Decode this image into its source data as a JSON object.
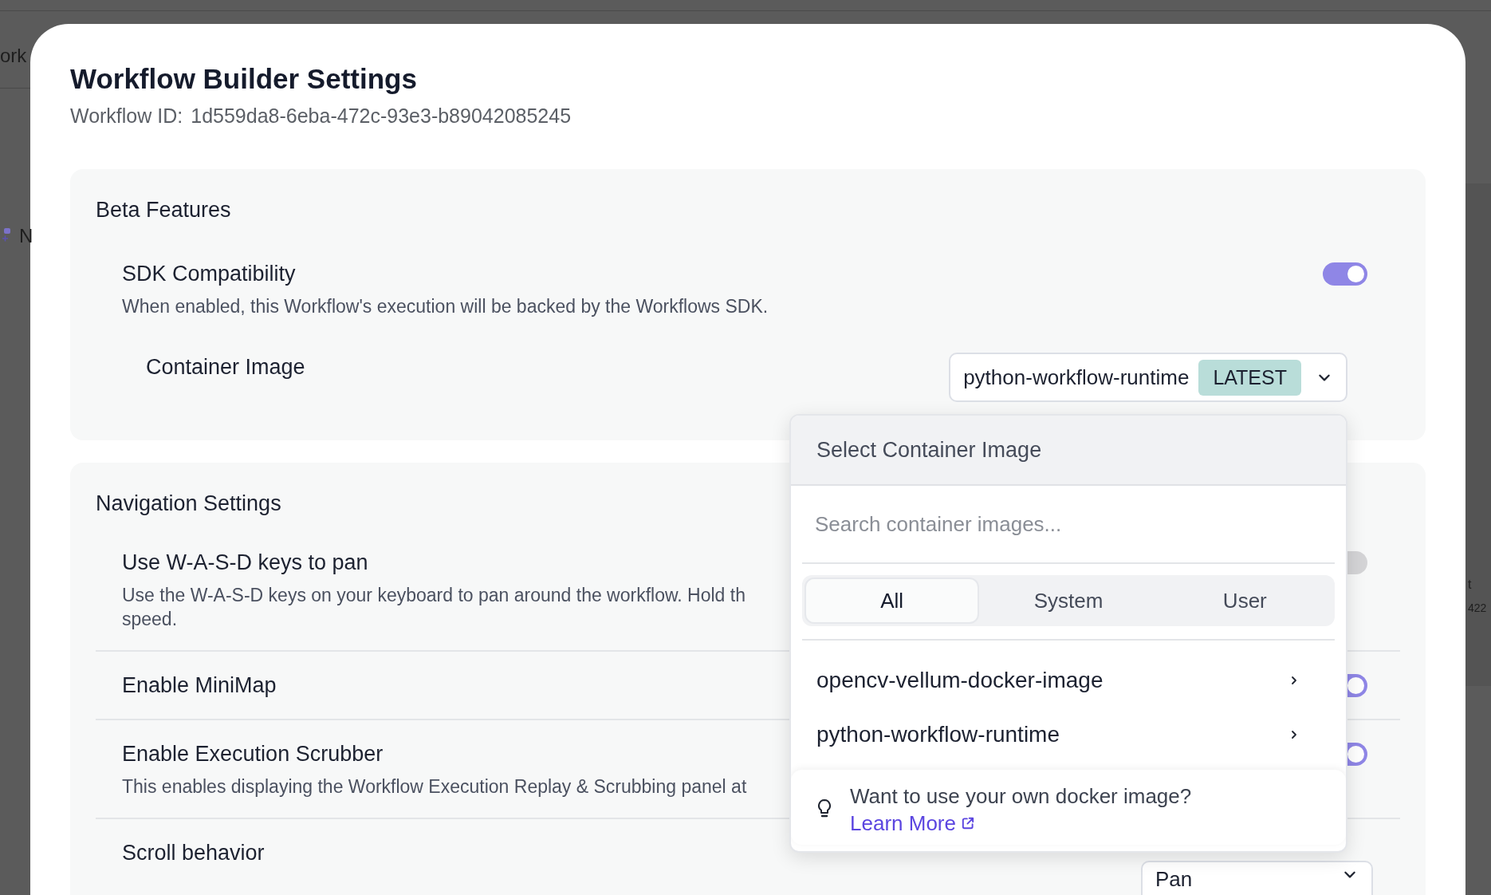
{
  "background": {
    "texts": [
      {
        "kind": "top-left",
        "text": "ork"
      },
      {
        "kind": "node",
        "text": "N"
      },
      {
        "kind": "right-a",
        "text": "t"
      },
      {
        "kind": "right-b",
        "text": "422"
      }
    ]
  },
  "dialog": {
    "title": "Workflow Builder Settings",
    "id_label": "Workflow ID:",
    "id_value": "1d559da8-6eba-472c-93e3-b89042085245"
  },
  "sections": [
    {
      "title": "Beta Features",
      "settings": [
        {
          "kind": "toggle",
          "label": "SDK Compatibility",
          "description": [
            "When enabled, this Workflow's execution will be backed by the Workflows SDK."
          ],
          "on": true,
          "children": [
            {
              "kind": "select",
              "label": "Container Image",
              "value": "python-workflow-runtime",
              "badge": "LATEST"
            }
          ]
        }
      ]
    },
    {
      "title": "Navigation Settings",
      "settings": [
        {
          "kind": "toggle",
          "label": "Use W-A-S-D keys to pan",
          "description": [
            "Use the W-A-S-D keys on your keyboard to pan around the workflow. Hold th",
            "speed."
          ],
          "on": false
        },
        {
          "kind": "toggle",
          "label": "Enable MiniMap",
          "on": true
        },
        {
          "kind": "toggle",
          "label": "Enable Execution Scrubber",
          "description": [
            "This enables displaying the Workflow Execution Replay & Scrubbing panel at"
          ],
          "on": true
        },
        {
          "kind": "select",
          "label": "Scroll behavior",
          "value": "Pan"
        }
      ]
    }
  ],
  "popover": {
    "title": "Select Container Image",
    "search_placeholder": "Search container images...",
    "tabs": [
      {
        "label": "All",
        "selected": true
      },
      {
        "label": "System",
        "selected": false
      },
      {
        "label": "User",
        "selected": false
      }
    ],
    "images": [
      "opencv-vellum-docker-image",
      "python-workflow-runtime"
    ],
    "tip": {
      "text": "Want to use your own docker image?",
      "link": "Learn More"
    }
  }
}
